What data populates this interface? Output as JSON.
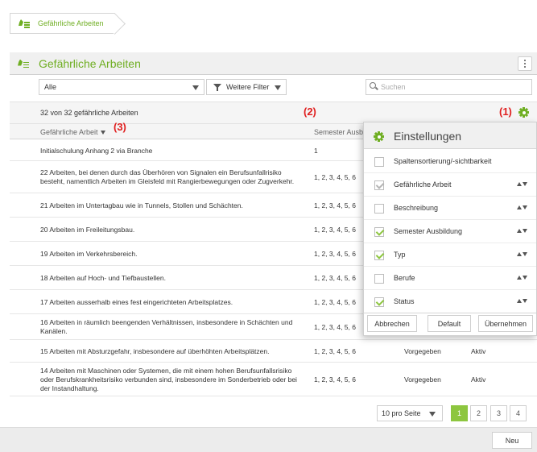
{
  "breadcrumb": {
    "label": "Gefährliche Arbeiten"
  },
  "header": {
    "title": "Gefährliche Arbeiten"
  },
  "filter": {
    "selected": "Alle",
    "more_filters": "Weitere Filter",
    "search_placeholder": "Suchen"
  },
  "count": "32 von 32 gefährliche Arbeiten",
  "annotations": {
    "a1": "(1)",
    "a2": "(2)",
    "a3": "(3)"
  },
  "columns": {
    "name": "Gefährliche Arbeit",
    "semester": "Semester Ausbi"
  },
  "rows": [
    {
      "name": "Initialschulung Anhang 2 via Branche",
      "semester": "1",
      "typ": "",
      "status": ""
    },
    {
      "name": "22 Arbeiten, bei denen durch das Überhören von Signalen ein Berufsunfallrisiko besteht, namentlich Arbeiten im Gleisfeld mit Rangierbewegungen oder Zugverkehr.",
      "semester": "1, 2, 3, 4, 5, 6",
      "typ": "",
      "status": ""
    },
    {
      "name": "21 Arbeiten im Untertagbau wie in Tunnels, Stollen und Schächten.",
      "semester": "1, 2, 3, 4, 5, 6",
      "typ": "",
      "status": ""
    },
    {
      "name": "20 Arbeiten im Freileitungsbau.",
      "semester": "1, 2, 3, 4, 5, 6",
      "typ": "",
      "status": ""
    },
    {
      "name": "19 Arbeiten im Verkehrsbereich.",
      "semester": "1, 2, 3, 4, 5, 6",
      "typ": "",
      "status": ""
    },
    {
      "name": "18 Arbeiten auf Hoch- und Tiefbaustellen.",
      "semester": "1, 2, 3, 4, 5, 6",
      "typ": "",
      "status": ""
    },
    {
      "name": "17 Arbeiten ausserhalb eines fest eingerichteten Arbeitsplatzes.",
      "semester": "1, 2, 3, 4, 5, 6",
      "typ": "",
      "status": ""
    },
    {
      "name": "16 Arbeiten in räumlich beengenden Verhältnissen, insbesondere in Schächten und Kanälen.",
      "semester": "1, 2, 3, 4, 5, 6",
      "typ": "",
      "status": ""
    },
    {
      "name": "15 Arbeiten mit Absturzgefahr, insbesondere auf überhöhten Arbeitsplätzen.",
      "semester": "1, 2, 3, 4, 5, 6",
      "typ": "Vorgegeben",
      "status": "Aktiv"
    },
    {
      "name": "14 Arbeiten mit Maschinen oder Systemen, die mit einem hohen Berufsunfallsrisiko oder Berufskrankheitsrisiko verbunden sind, insbesondere im Sonderbetrieb oder bei der Instandhaltung.",
      "semester": "1, 2, 3, 4, 5, 6",
      "typ": "Vorgegeben",
      "status": "Aktiv"
    }
  ],
  "pager": {
    "per_page": "10 pro Seite",
    "pages": [
      "1",
      "2",
      "3",
      "4"
    ],
    "active": "1"
  },
  "footer": {
    "new": "Neu"
  },
  "settings": {
    "title": "Einstellungen",
    "items": [
      {
        "label": "Spaltensortierung/-sichtbarkeit",
        "checked": false,
        "sortable": false
      },
      {
        "label": "Gefährliche Arbeit",
        "checked": true,
        "muted": true,
        "sortable": true
      },
      {
        "label": "Beschreibung",
        "checked": false,
        "sortable": true
      },
      {
        "label": "Semester Ausbildung",
        "checked": true,
        "sortable": true
      },
      {
        "label": "Typ",
        "checked": true,
        "sortable": true
      },
      {
        "label": "Berufe",
        "checked": false,
        "sortable": true
      },
      {
        "label": "Status",
        "checked": true,
        "sortable": true
      }
    ],
    "cancel": "Abbrechen",
    "default": "Default",
    "apply": "Übernehmen"
  },
  "colors": {
    "accent": "#6fae22",
    "active_page": "#8dc63f",
    "annotation": "#e02020"
  }
}
